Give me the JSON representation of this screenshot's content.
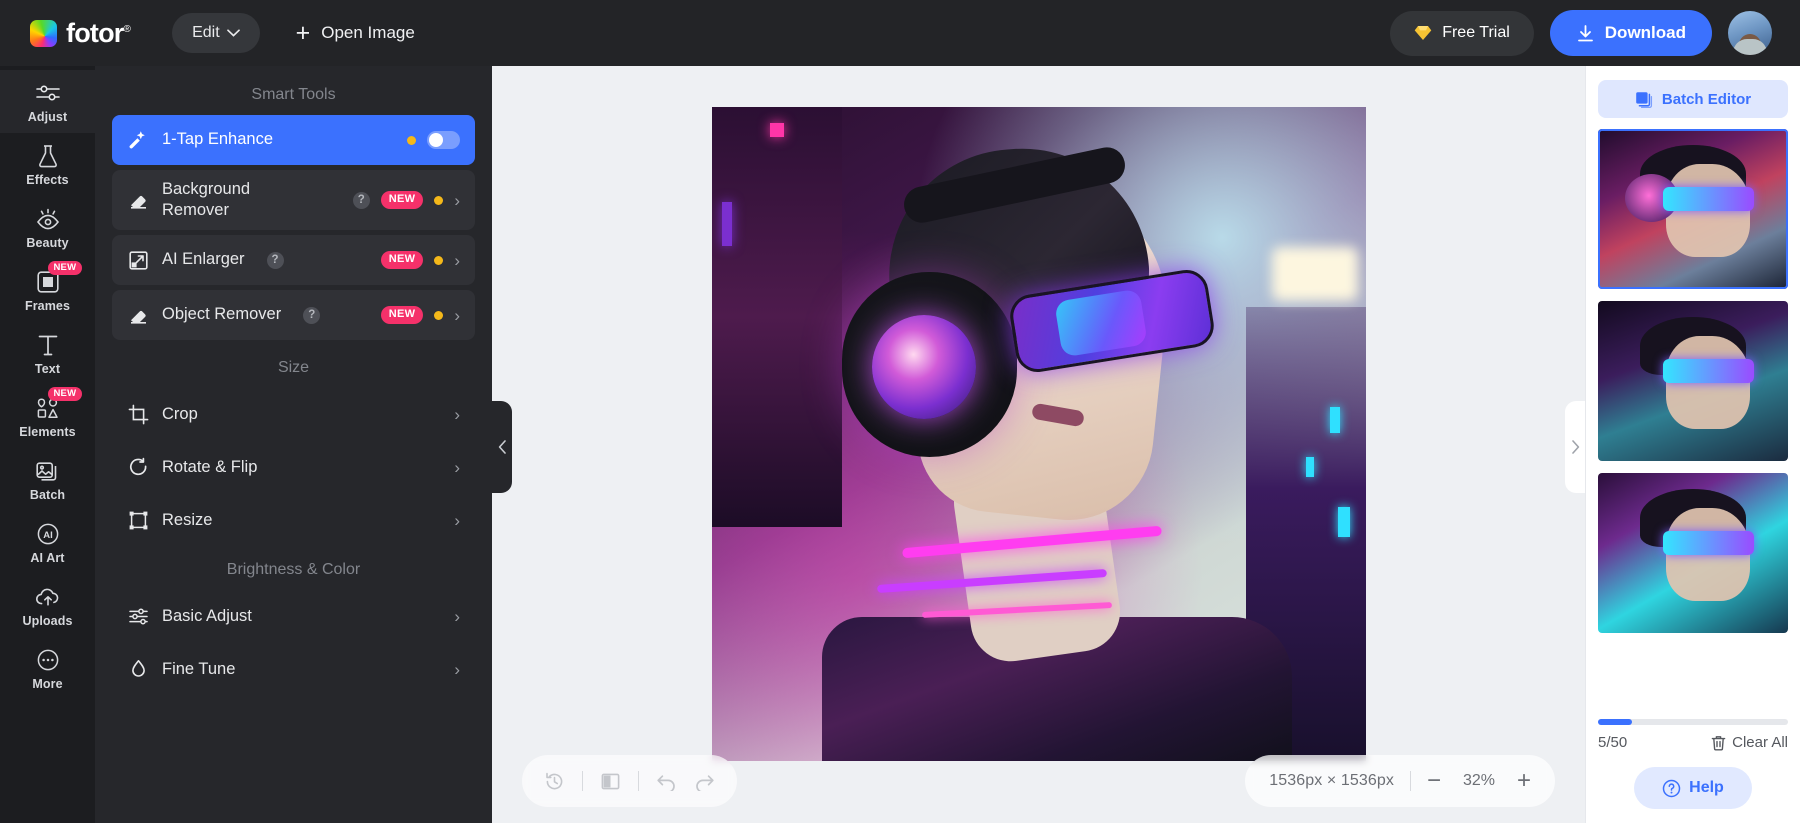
{
  "topbar": {
    "brand": "fotor",
    "brand_reg": "®",
    "edit_label": "Edit",
    "open_image_label": "Open Image",
    "free_trial_label": "Free Trial",
    "download_label": "Download",
    "icons": {
      "gem": "gem-icon",
      "plus": "plus-icon",
      "chevron_down": "chevron-down-icon",
      "download": "download-icon",
      "avatar": "user-avatar"
    }
  },
  "rail": {
    "items": [
      {
        "label": "Adjust",
        "icon": "sliders-icon",
        "active": true,
        "badge": ""
      },
      {
        "label": "Effects",
        "icon": "flask-icon",
        "active": false,
        "badge": ""
      },
      {
        "label": "Beauty",
        "icon": "eye-icon",
        "active": false,
        "badge": ""
      },
      {
        "label": "Frames",
        "icon": "frame-icon",
        "active": false,
        "badge": "NEW"
      },
      {
        "label": "Text",
        "icon": "text-icon",
        "active": false,
        "badge": ""
      },
      {
        "label": "Elements",
        "icon": "shapes-icon",
        "active": false,
        "badge": "NEW"
      },
      {
        "label": "Batch",
        "icon": "images-icon",
        "active": false,
        "badge": ""
      },
      {
        "label": "AI Art",
        "icon": "ai-circle-icon",
        "active": false,
        "badge": ""
      },
      {
        "label": "Uploads",
        "icon": "cloud-up-icon",
        "active": false,
        "badge": ""
      },
      {
        "label": "More",
        "icon": "ellipsis-icon",
        "active": false,
        "badge": ""
      }
    ]
  },
  "panel": {
    "sections": [
      {
        "title": "Smart Tools",
        "rows": [
          {
            "label": "1-Tap Enhance",
            "icon": "magic-wand-icon",
            "selected": true,
            "help": false,
            "badge": "",
            "pro": true,
            "control": "toggle"
          },
          {
            "label": "Background Remover",
            "icon": "eraser-icon",
            "selected": false,
            "help": true,
            "badge": "NEW",
            "pro": true,
            "control": "chevron"
          },
          {
            "label": "AI Enlarger",
            "icon": "expand-icon",
            "selected": false,
            "help": true,
            "badge": "NEW",
            "pro": true,
            "control": "chevron"
          },
          {
            "label": "Object Remover",
            "icon": "eraser-icon",
            "selected": false,
            "help": true,
            "badge": "NEW",
            "pro": true,
            "control": "chevron"
          }
        ]
      },
      {
        "title": "Size",
        "rows": [
          {
            "label": "Crop",
            "icon": "crop-icon",
            "selected": false,
            "help": false,
            "badge": "",
            "pro": false,
            "control": "chevron"
          },
          {
            "label": "Rotate & Flip",
            "icon": "rotate-icon",
            "selected": false,
            "help": false,
            "badge": "",
            "pro": false,
            "control": "chevron"
          },
          {
            "label": "Resize",
            "icon": "resize-icon",
            "selected": false,
            "help": false,
            "badge": "",
            "pro": false,
            "control": "chevron"
          }
        ]
      },
      {
        "title": "Brightness & Color",
        "rows": [
          {
            "label": "Basic Adjust",
            "icon": "adjust-sliders-icon",
            "selected": false,
            "help": false,
            "badge": "",
            "pro": false,
            "control": "chevron"
          },
          {
            "label": "Fine Tune",
            "icon": "droplet-icon",
            "selected": false,
            "help": false,
            "badge": "",
            "pro": false,
            "control": "chevron"
          }
        ]
      }
    ],
    "collapse_left_icon": "chevron-left-icon"
  },
  "canvas": {
    "bottom_left_tools": [
      {
        "icon": "history-icon",
        "name": "history-button"
      },
      {
        "icon": "compare-icon",
        "name": "compare-button"
      },
      {
        "icon": "undo-icon",
        "name": "undo-button"
      },
      {
        "icon": "redo-icon",
        "name": "redo-button"
      }
    ],
    "dimensions": "1536px × 1536px",
    "zoom_level": "32%",
    "zoom_out_label": "−",
    "zoom_in_label": "+",
    "collapse_right_icon": "chevron-right-icon"
  },
  "right_panel": {
    "batch_editor_label": "Batch Editor",
    "batch_icon": "layers-icon",
    "thumbnails": [
      {
        "name": "thumbnail-1",
        "selected": true
      },
      {
        "name": "thumbnail-2",
        "selected": false
      },
      {
        "name": "thumbnail-3",
        "selected": false
      }
    ],
    "count_label": "5/50",
    "progress_percent": 10,
    "clear_all_label": "Clear All",
    "trash_icon": "trash-icon",
    "help_label": "Help",
    "help_icon": "question-circle-icon"
  },
  "colors": {
    "accent_blue": "#3b71fe",
    "badge_pink": "#f5316a",
    "pro_yellow": "#f4b81a",
    "topbar_bg": "#232427",
    "rail_bg": "#1c1d20",
    "panel_bg": "#26272b"
  }
}
